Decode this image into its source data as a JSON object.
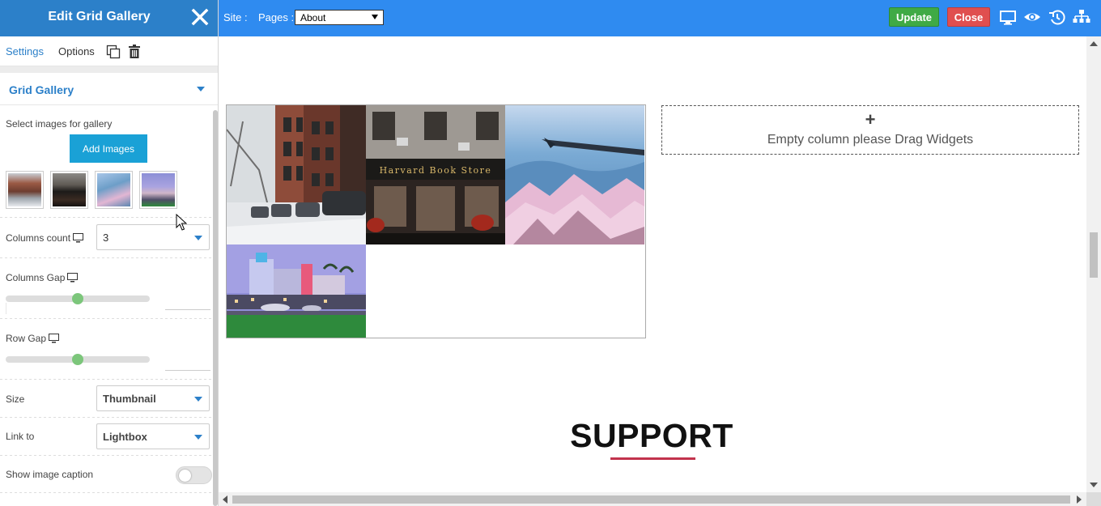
{
  "panel": {
    "title": "Edit Grid Gallery",
    "tabs": {
      "settings": "Settings",
      "options": "Options"
    },
    "section": {
      "title": "Grid Gallery"
    },
    "select_images_label": "Select images for gallery",
    "add_images_label": "Add Images",
    "thumbnails": [
      "street-snow",
      "harvard-book-store",
      "airplane-wing",
      "art-deco-hotel"
    ],
    "columns_count": {
      "label": "Columns count",
      "value": "3"
    },
    "columns_gap": {
      "label": "Columns Gap",
      "level": 0.5
    },
    "row_gap": {
      "label": "Row Gap",
      "level": 0.5
    },
    "size": {
      "label": "Size",
      "value": "Thumbnail"
    },
    "link_to": {
      "label": "Link to",
      "value": "Lightbox"
    },
    "show_caption": {
      "label": "Show image caption",
      "enabled": false
    }
  },
  "topbar": {
    "site_label": "Site :",
    "pages_label": "Pages :",
    "pages_value": "About",
    "update_label": "Update",
    "close_label": "Close",
    "icons": [
      "desktop-icon",
      "eye-icon",
      "history-icon",
      "sitemap-icon"
    ]
  },
  "canvas": {
    "gallery_images": [
      "street-snow",
      "harvard-book-store",
      "airplane-wing",
      "art-deco-hotel"
    ],
    "harvard_sign": "Harvard Book Store",
    "empty_column": {
      "plus": "+",
      "text": "Empty column please Drag Widgets"
    },
    "support_title": "SUPPORT"
  },
  "colors": {
    "panel_header": "#2c80c9",
    "topbar": "#2f8bf0",
    "update": "#3faa45",
    "close": "#e04f4f",
    "add_images": "#1aa1d6",
    "slider_knob": "#7cc67b",
    "support_underline": "#c2334d"
  }
}
